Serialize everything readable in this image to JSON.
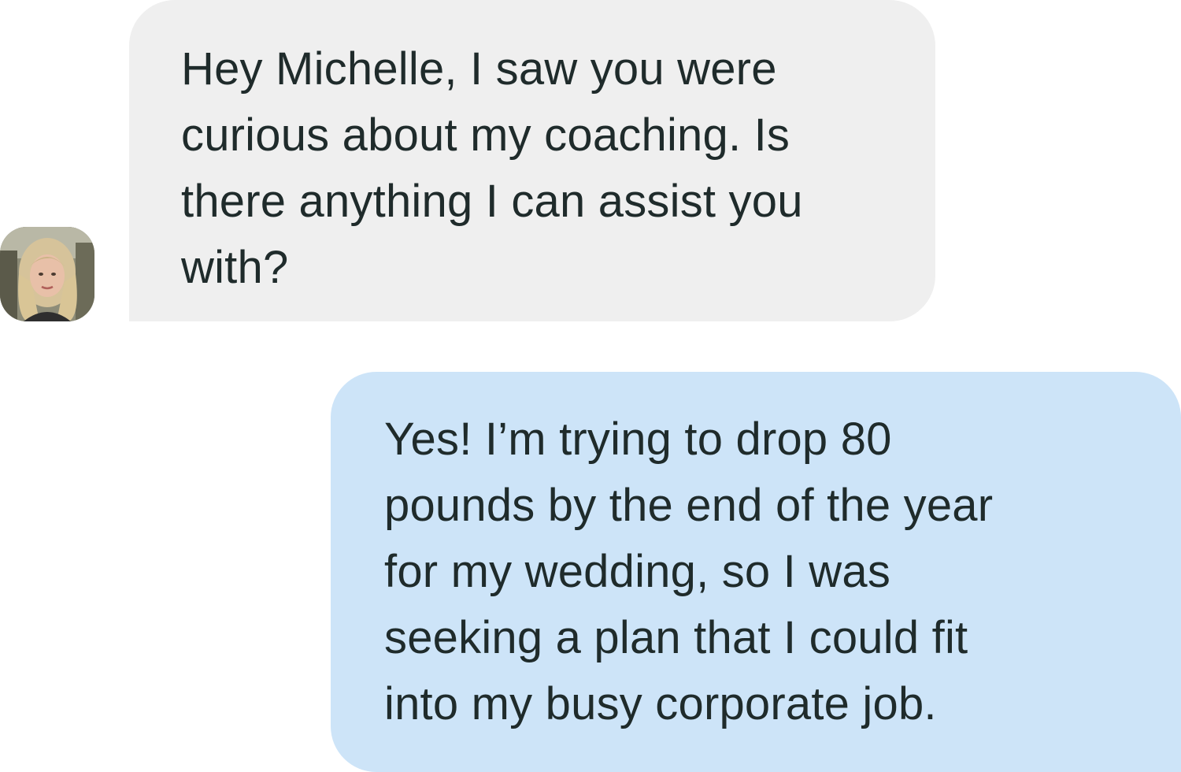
{
  "conversation": {
    "incoming": {
      "lines": [
        "Hey Michelle, I saw you were",
        "curious about my coaching. Is",
        "there anything I can assist you",
        "with?"
      ],
      "avatar_icon": "user-photo-avatar",
      "bubble_color": "#efefef"
    },
    "outgoing": {
      "lines": [
        "Yes! I’m trying to drop 80",
        "pounds by the end of the year",
        "for my wedding, so I was",
        "seeking a plan that I could fit",
        "into my busy corporate job."
      ],
      "bubble_color": "#cde4f8"
    },
    "text_color": "#1f2b2b"
  }
}
